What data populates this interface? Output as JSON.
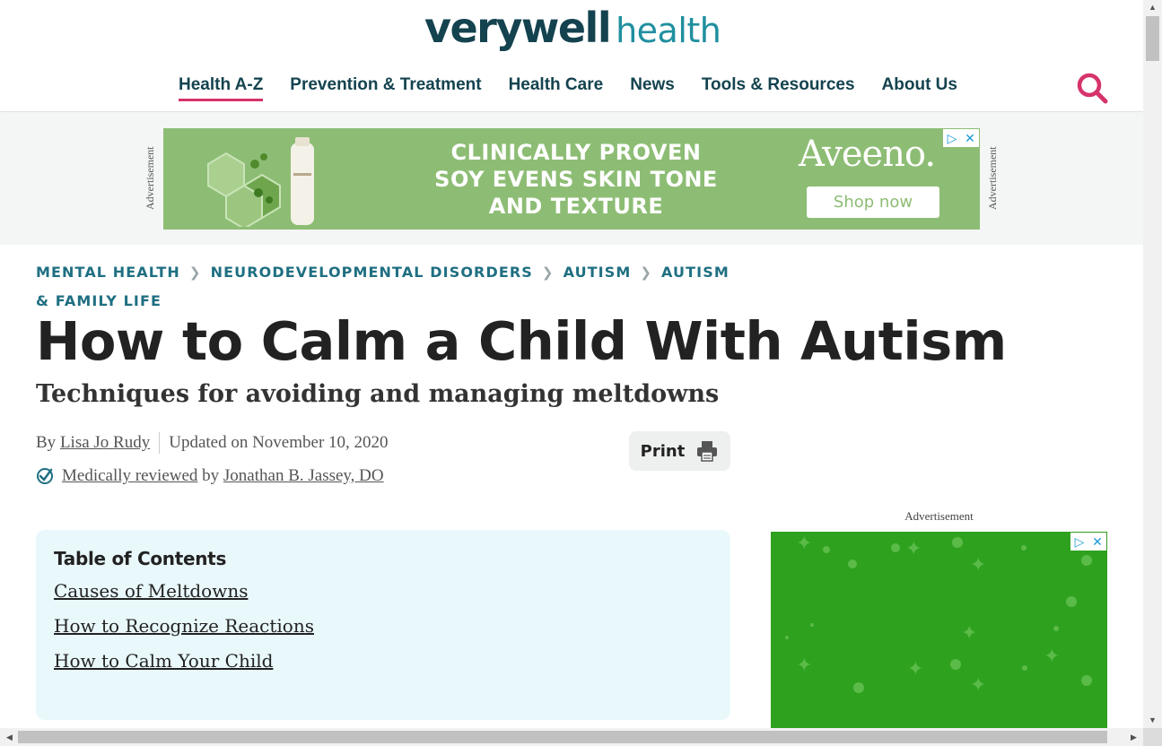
{
  "brand": {
    "main": "verywell",
    "sub": "health"
  },
  "nav": {
    "items": [
      {
        "label": "Health A-Z",
        "active": true
      },
      {
        "label": "Prevention & Treatment"
      },
      {
        "label": "Health Care"
      },
      {
        "label": "News"
      },
      {
        "label": "Tools & Resources"
      },
      {
        "label": "About Us"
      }
    ],
    "search_icon": "search-icon"
  },
  "top_ad": {
    "label": "Advertisement",
    "headline_lines": [
      "CLINICALLY PROVEN",
      "SOY EVENS SKIN TONE",
      "AND TEXTURE"
    ],
    "brand": "Aveeno.",
    "cta": "Shop now",
    "background": "#8dbd74"
  },
  "breadcrumb": [
    "MENTAL HEALTH",
    "NEURODEVELOPMENTAL DISORDERS",
    "AUTISM",
    "AUTISM & FAMILY LIFE"
  ],
  "article": {
    "title": "How to Calm a Child With Autism",
    "subtitle": "Techniques for avoiding and managing meltdowns",
    "by_prefix": "By",
    "author": "Lisa Jo Rudy",
    "updated": "Updated on November 10, 2020",
    "reviewed_link": "Medically reviewed",
    "reviewed_by": "by",
    "reviewer": "Jonathan B. Jassey, DO",
    "print_label": "Print"
  },
  "toc": {
    "title": "Table of Contents",
    "items": [
      "Causes of Meltdowns",
      "How to Recognize Reactions",
      "How to Calm Your Child"
    ]
  },
  "side_ad": {
    "label": "Advertisement",
    "background": "#2ea11f"
  },
  "colors": {
    "brand_dark": "#14434f",
    "brand_teal": "#1f8f9f",
    "accent": "#d6336c",
    "breadcrumb": "#1f6f82",
    "toc_bg": "#e9f8fb"
  }
}
